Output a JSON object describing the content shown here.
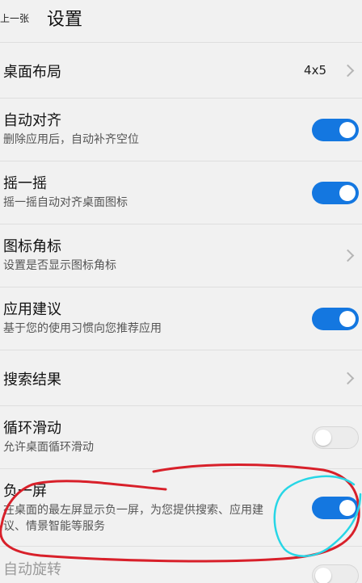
{
  "header": {
    "back_label": "上一张",
    "title": "设置"
  },
  "settings": [
    {
      "title": "桌面布局",
      "value": "4x5",
      "control": "chevron"
    },
    {
      "title": "自动对齐",
      "subtitle": "删除应用后，自动补齐空位",
      "control": "toggle",
      "on": true
    },
    {
      "title": "摇一摇",
      "subtitle": "摇一摇自动对齐桌面图标",
      "control": "toggle",
      "on": true
    },
    {
      "title": "图标角标",
      "subtitle": "设置是否显示图标角标",
      "control": "chevron"
    },
    {
      "title": "应用建议",
      "subtitle": "基于您的使用习惯向您推荐应用",
      "control": "toggle",
      "on": true
    },
    {
      "title": "搜索结果",
      "control": "chevron"
    },
    {
      "title": "循环滑动",
      "subtitle": "允许桌面循环滑动",
      "control": "toggle",
      "on": false
    },
    {
      "title": "负一屏",
      "subtitle": "在桌面的最左屏显示负一屏，为您提供搜索、应用建议、情景智能等服务",
      "control": "toggle",
      "on": true
    },
    {
      "title": "自动旋转",
      "control": "toggle",
      "on": false
    }
  ],
  "colors": {
    "toggle_on": "#1477e0",
    "background": "#f1f1f1",
    "annotation_red": "#d8202a",
    "annotation_cyan": "#27d6e6"
  }
}
